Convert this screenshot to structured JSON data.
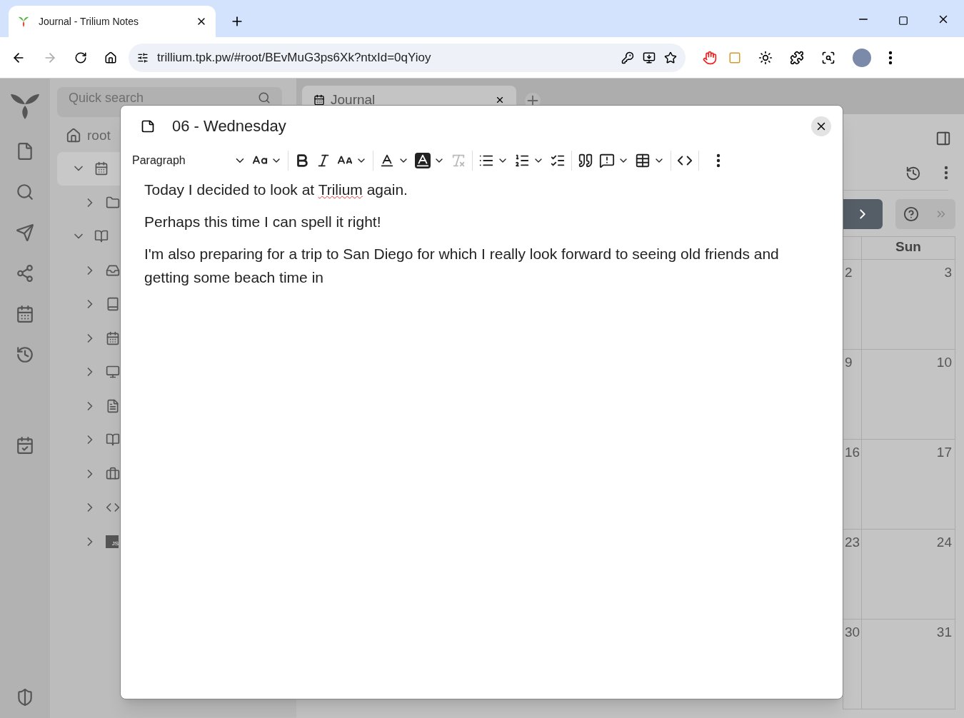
{
  "browser": {
    "tab_title": "Journal - Trilium Notes",
    "url": "trillium.tpk.pw/#root/BEvMuG3ps6Xk?ntxId=0qYioy"
  },
  "search": {
    "placeholder": "Quick search"
  },
  "note_tabs": [
    {
      "label": "Journal",
      "selected": true
    }
  ],
  "breadcrumb": "root",
  "tree": [
    {
      "kind": "calendar",
      "expanded": true,
      "selected": true
    },
    {
      "kind": "folder",
      "expanded": false,
      "selected": false
    },
    {
      "kind": "book-reader",
      "expanded": true,
      "selected": false
    },
    {
      "kind": "inbox",
      "expanded": false,
      "selected": false
    },
    {
      "kind": "book",
      "expanded": false,
      "selected": false
    },
    {
      "kind": "calendar",
      "expanded": false,
      "selected": false
    },
    {
      "kind": "monitor",
      "expanded": false,
      "selected": false
    },
    {
      "kind": "file",
      "expanded": false,
      "selected": false
    },
    {
      "kind": "book-open",
      "expanded": false,
      "selected": false
    },
    {
      "kind": "briefcase",
      "expanded": false,
      "selected": false
    },
    {
      "kind": "code",
      "expanded": false,
      "selected": false
    },
    {
      "kind": "js",
      "expanded": false,
      "selected": false,
      "label": "JS"
    }
  ],
  "calendar": {
    "header": "Sun",
    "rows": [
      [
        "2",
        "3"
      ],
      [
        "9",
        "10"
      ],
      [
        "16",
        "17"
      ],
      [
        "23",
        "24"
      ],
      [
        "30",
        "31"
      ]
    ]
  },
  "dialog": {
    "title": "06 - Wednesday",
    "block_style": "Paragraph",
    "toolbar": [
      {
        "kind": "heading",
        "disabled": false
      },
      {
        "kind": "caret",
        "disabled": false
      },
      {
        "kind": "sep"
      },
      {
        "kind": "bold",
        "disabled": false
      },
      {
        "kind": "italic",
        "disabled": false
      },
      {
        "kind": "font-size",
        "disabled": false
      },
      {
        "kind": "caret",
        "disabled": false
      },
      {
        "kind": "sep"
      },
      {
        "kind": "font-color",
        "disabled": false
      },
      {
        "kind": "caret",
        "disabled": false
      },
      {
        "kind": "highlight",
        "disabled": false
      },
      {
        "kind": "caret",
        "disabled": false
      },
      {
        "kind": "remove-format",
        "disabled": true
      },
      {
        "kind": "sep"
      },
      {
        "kind": "bullet-list",
        "disabled": false
      },
      {
        "kind": "caret",
        "disabled": false
      },
      {
        "kind": "numbered-list",
        "disabled": false
      },
      {
        "kind": "caret",
        "disabled": false
      },
      {
        "kind": "todo-list",
        "disabled": false
      },
      {
        "kind": "sep"
      },
      {
        "kind": "quote",
        "disabled": false
      },
      {
        "kind": "admonition",
        "disabled": false
      },
      {
        "kind": "caret",
        "disabled": false
      },
      {
        "kind": "table",
        "disabled": false
      },
      {
        "kind": "caret",
        "disabled": false
      },
      {
        "kind": "sep"
      },
      {
        "kind": "code",
        "disabled": false
      },
      {
        "kind": "sep"
      },
      {
        "kind": "more",
        "disabled": false
      }
    ],
    "paragraphs": [
      [
        {
          "text": "Today I decided to look at ",
          "misspelled": false
        },
        {
          "text": "Trilium",
          "misspelled": true
        },
        {
          "text": " again.",
          "misspelled": false
        }
      ],
      [
        {
          "text": "Perhaps this time I can spell it right!",
          "misspelled": false
        }
      ],
      [
        {
          "text": "I'm also preparing for a trip to San Diego for which I really look forward to seeing old friends and getting some beach time in",
          "misspelled": false
        }
      ]
    ]
  }
}
